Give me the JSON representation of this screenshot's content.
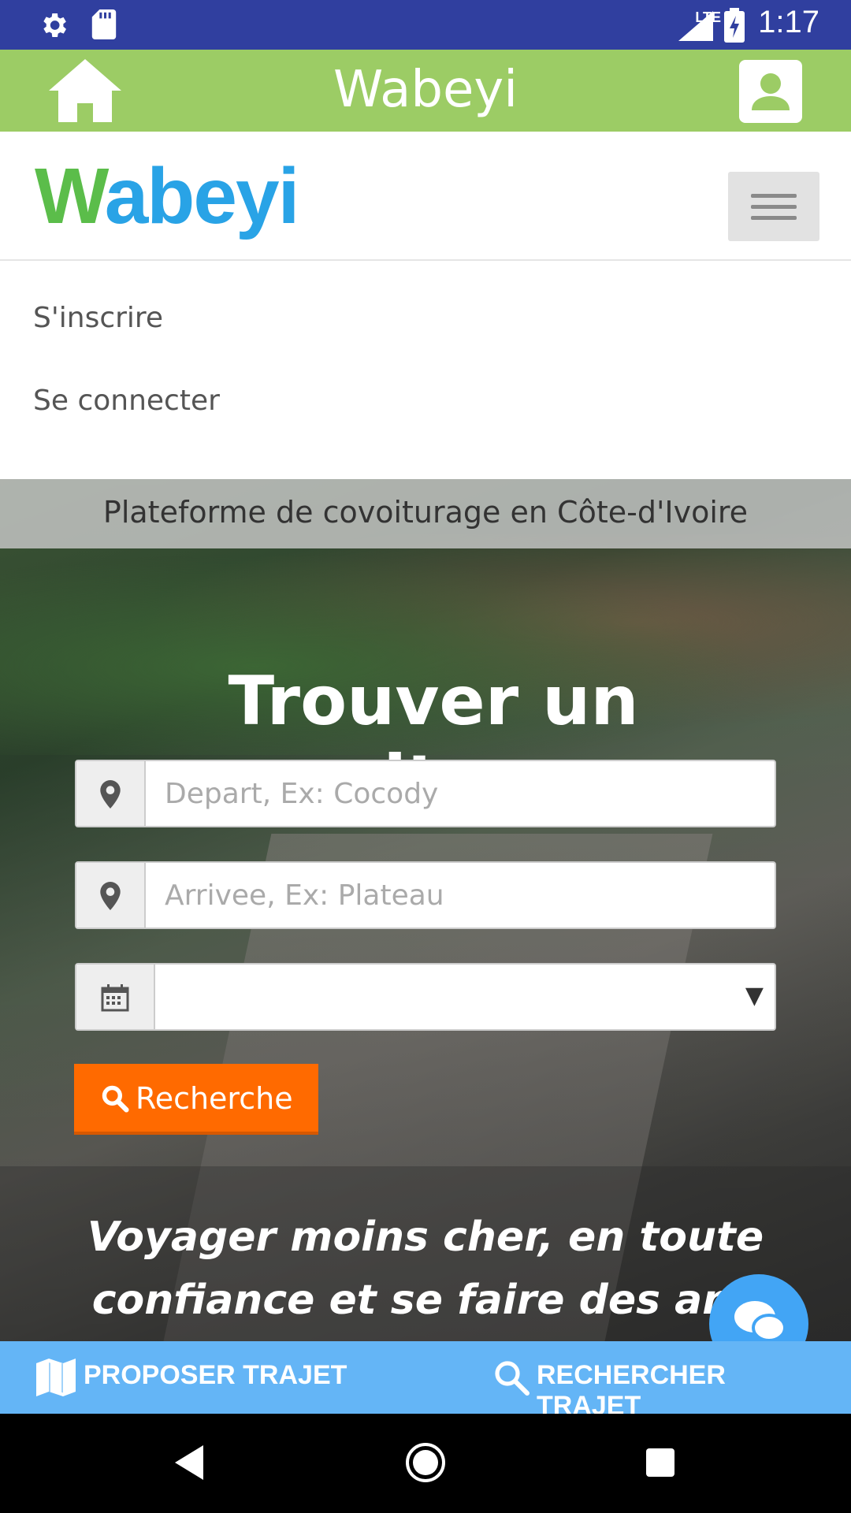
{
  "status_bar": {
    "time": "1:17",
    "network": "LTE"
  },
  "app_bar": {
    "title": "Wabeyi"
  },
  "site": {
    "logo_text_w": "W",
    "logo_text_rest": "abeyi",
    "menu": [
      "S'inscrire",
      "Se connecter"
    ]
  },
  "hero": {
    "tagline": "Plateforme de covoiturage en Côte-d'Ivoire",
    "title": "Trouver un covoiturage",
    "departure_placeholder": "Depart, Ex: Cocody",
    "arrival_placeholder": "Arrivee, Ex: Plateau",
    "date_value": "",
    "search_label": "Recherche",
    "slogan_line1": "Voyager moins cher, en toute",
    "slogan_line2": "confiance et se faire des ami"
  },
  "bottom_bar": {
    "propose_label": "PROPOSER TRAJET",
    "search_label": "RECHERCHER TRAJET"
  },
  "colors": {
    "status_bar": "#303f9f",
    "app_bar": "#9ccc65",
    "search_button": "#ff6a00",
    "bottom_bar": "#64b5f6"
  }
}
